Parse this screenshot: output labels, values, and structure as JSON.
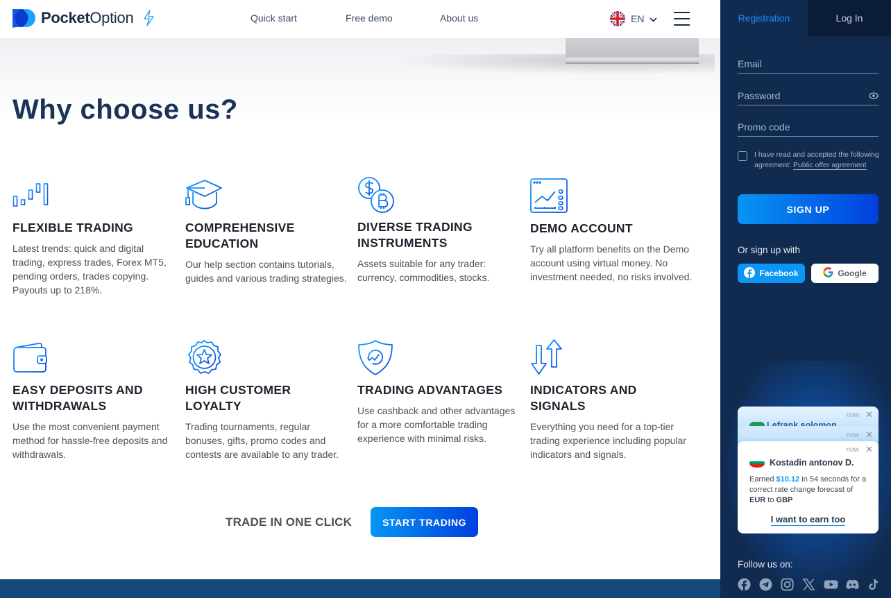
{
  "header": {
    "brand_bold": "Pocket",
    "brand_light": "Option",
    "nav": [
      {
        "label": "Quick start"
      },
      {
        "label": "Free demo"
      },
      {
        "label": "About us"
      }
    ],
    "language": "EN",
    "language_icon": "uk-flag-icon",
    "menu_icon": "hamburger-menu-icon"
  },
  "main": {
    "title": "Why choose us?",
    "features": [
      {
        "icon": "candlestick-chart-icon",
        "title": "FLEXIBLE TRADING",
        "text": "Latest trends: quick and digital trading, express trades, Forex MT5, pending orders, trades copying. Payouts up to 218%."
      },
      {
        "icon": "graduation-cap-icon",
        "title": "COMPREHENSIVE EDUCATION",
        "text": "Our help section contains tutorials, guides and various trading strategies."
      },
      {
        "icon": "dollar-bitcoin-icon",
        "title": "DIVERSE TRADING INSTRUMENTS",
        "text": "Assets suitable for any trader: currency, commodities, stocks."
      },
      {
        "icon": "demo-chart-window-icon",
        "title": "DEMO ACCOUNT",
        "text": "Try all platform benefits on the Demo account using virtual money. No investment needed, no risks involved."
      },
      {
        "icon": "wallet-icon",
        "title": "EASY DEPOSITS AND WITHDRAWALS",
        "text": "Use the most convenient payment method for hassle-free deposits and withdrawals."
      },
      {
        "icon": "star-badge-icon",
        "title": "HIGH CUSTOMER LOYALTY",
        "text": "Trading tournaments, regular bonuses, gifts, promo codes and contests are available to any trader."
      },
      {
        "icon": "shield-check-icon",
        "title": "TRADING ADVANTAGES",
        "text": "Use cashback and other advantages for a more comfortable trading experience with minimal risks."
      },
      {
        "icon": "up-down-arrows-icon",
        "title": "INDICATORS AND SIGNALS",
        "text": "Everything you need for a top-tier trading experience including popular indicators and signals."
      }
    ],
    "cta_label": "TRADE IN ONE CLICK",
    "cta_button": "START TRADING"
  },
  "sidebar": {
    "tabs": [
      {
        "label": "Registration",
        "active": true
      },
      {
        "label": "Log In",
        "active": false
      }
    ],
    "email_placeholder": "Email",
    "email_value": "",
    "password_placeholder": "Password",
    "password_value": "",
    "promo_placeholder": "Promo code",
    "promo_value": "",
    "agreement_text": "I have read and accepted the following agreement: ",
    "agreement_link": "Public offer agreement",
    "agreement_checked": false,
    "signup_button": "SIGN UP",
    "or_sign_up_with": "Or sign up with",
    "facebook_label": "Facebook",
    "google_label": "Google",
    "notifications": [
      {
        "time": "now",
        "name": "Lefrank solomon"
      },
      {
        "time": "now",
        "name": ""
      },
      {
        "time": "now",
        "name": "Kostadin antonov D.",
        "earned_prefix": "Earned ",
        "amount": "$10.12",
        "duration_text": " in 54 seconds for a correct rate change forecast of ",
        "from_currency": "EUR",
        "to_word": " to ",
        "to_currency": "GBP",
        "cta": "I want to earn too"
      }
    ],
    "follow_label": "Follow us on:",
    "social_icons": [
      "facebook-icon",
      "telegram-icon",
      "instagram-icon",
      "x-icon",
      "youtube-icon",
      "discord-icon",
      "tiktok-icon"
    ]
  },
  "colors": {
    "accent": "#0b96f5",
    "accent_dark": "#0140de",
    "sidebar_bg": "#112a4f",
    "title": "#1a3356",
    "footer_band": "#134a7b"
  }
}
